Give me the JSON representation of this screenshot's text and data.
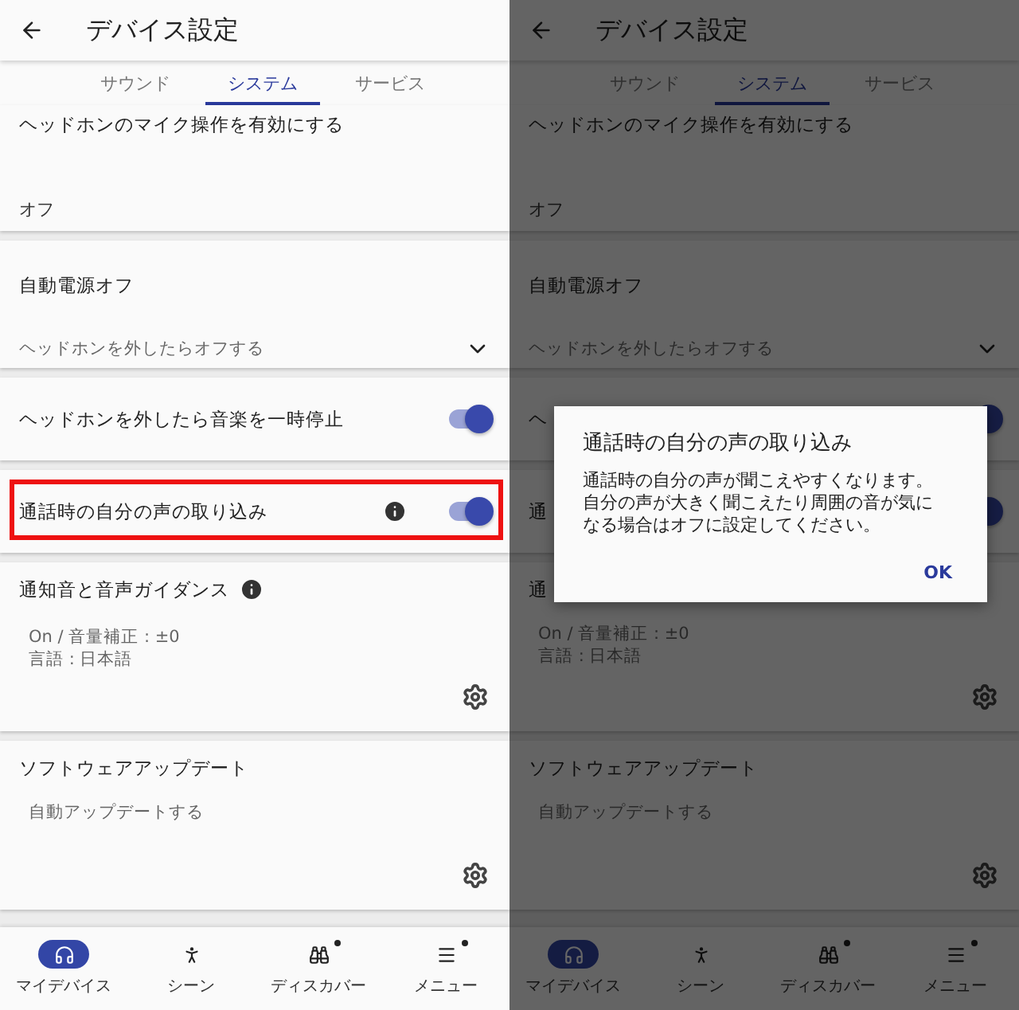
{
  "screens": [
    {
      "title": "デバイス設定",
      "tabs": [
        {
          "label": "サウンド",
          "selected": false
        },
        {
          "label": "システム",
          "selected": true
        },
        {
          "label": "サービス",
          "selected": false
        }
      ],
      "cards": [
        {
          "kind": "value",
          "title": "ヘッドホンのマイク操作を有効にする",
          "value": "オフ"
        },
        {
          "kind": "dropdown",
          "title": "自動電源オフ",
          "value": "ヘッドホンを外したらオフする"
        },
        {
          "kind": "toggle",
          "title": "ヘッドホンを外したら音楽を一時停止",
          "on": true,
          "info": false,
          "highlighted": false
        },
        {
          "kind": "toggle",
          "title": "通話時の自分の声の取り込み",
          "on": true,
          "info": true,
          "highlighted": true
        },
        {
          "kind": "detail",
          "title": "通知音と音声ガイダンス",
          "info": true,
          "lines": [
            "On / 音量補正 : ±0",
            "言語 : 日本語"
          ]
        },
        {
          "kind": "detail",
          "title": "ソフトウェアアップデート",
          "info": false,
          "lines": [
            "自動アップデートする"
          ]
        }
      ],
      "nav": [
        {
          "label": "マイデバイス",
          "selected": true,
          "badge": false
        },
        {
          "label": "シーン",
          "selected": false,
          "badge": false
        },
        {
          "label": "ディスカバー",
          "selected": false,
          "badge": true
        },
        {
          "label": "メニュー",
          "selected": false,
          "badge": true
        }
      ]
    },
    {
      "title": "デバイス設定",
      "tabs": [
        {
          "label": "サウンド",
          "selected": false
        },
        {
          "label": "システム",
          "selected": true
        },
        {
          "label": "サービス",
          "selected": false
        }
      ],
      "cards": [
        {
          "kind": "value",
          "title": "ヘッドホンのマイク操作を有効にする",
          "value": "オフ"
        },
        {
          "kind": "dropdown",
          "title": "自動電源オフ",
          "value": "ヘッドホンを外したらオフする"
        },
        {
          "kind": "toggle",
          "title": "ヘ",
          "on": true,
          "info": false,
          "highlighted": false
        },
        {
          "kind": "toggle",
          "title": "通",
          "on": true,
          "info": false,
          "highlighted": false
        },
        {
          "kind": "detail",
          "title": "通",
          "info": false,
          "lines": [
            "On / 音量補正 : ±0",
            "言語 : 日本語"
          ]
        },
        {
          "kind": "detail",
          "title": "ソフトウェアアップデート",
          "info": false,
          "lines": [
            "自動アップデートする"
          ]
        }
      ],
      "nav": [
        {
          "label": "マイデバイス",
          "selected": true,
          "badge": false
        },
        {
          "label": "シーン",
          "selected": false,
          "badge": false
        },
        {
          "label": "ディスカバー",
          "selected": false,
          "badge": true
        },
        {
          "label": "メニュー",
          "selected": false,
          "badge": true
        }
      ],
      "dialog": {
        "title": "通話時の自分の声の取り込み",
        "body": [
          "通話時の自分の声が聞こえやすくなります。",
          "自分の声が大きく聞こえたり周囲の音が気に",
          "なる場合はオフに設定してください。"
        ],
        "button": "OK"
      }
    }
  ]
}
